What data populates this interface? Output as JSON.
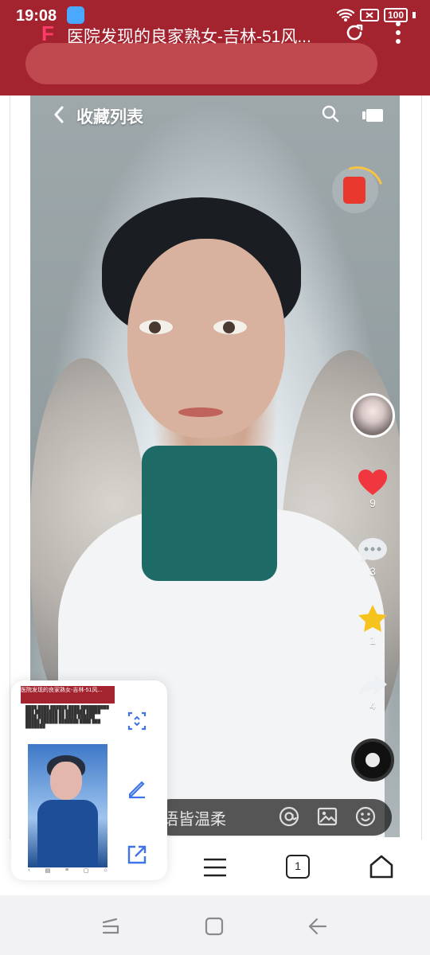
{
  "status_bar": {
    "time": "19:08",
    "app_icon": "toutiao-app-icon",
    "battery": "100",
    "icons": [
      "wifi-icon",
      "sim-x-icon",
      "battery-icon",
      "charging-icon"
    ]
  },
  "browser": {
    "page_title": "医院发现的良家熟女-吉林-51风...",
    "icons": [
      "site-logo-icon",
      "reload-icon",
      "more-icon"
    ]
  },
  "video": {
    "header_title": "收藏列表",
    "likes": "9",
    "comments": "3",
    "favorites": "1",
    "shares": "4",
    "comment_placeholder": "语皆温柔",
    "icons": [
      "back-icon",
      "search-icon",
      "screen-icon",
      "red-packet-icon",
      "heart-icon",
      "comment-icon",
      "star-icon",
      "share-icon",
      "music-disc-icon",
      "at-icon",
      "picture-icon",
      "emoji-icon"
    ]
  },
  "toolbar": {
    "tab_count": "1",
    "icons": [
      "menu-icon",
      "tabs-icon",
      "home-icon"
    ]
  },
  "screenshot_panel": {
    "thumb_title": "医院发现的良家熟女-吉林-51风...",
    "icons": [
      "scroll-capture-icon",
      "edit-icon",
      "share-out-icon"
    ]
  },
  "system_nav": {
    "icons": [
      "recents-icon",
      "home-nav-icon",
      "back-nav-icon"
    ]
  },
  "colors": {
    "browser_red": "#a3232f",
    "heart": "#f0373f",
    "star": "#f6c21e",
    "link_blue": "#3f73e9"
  }
}
